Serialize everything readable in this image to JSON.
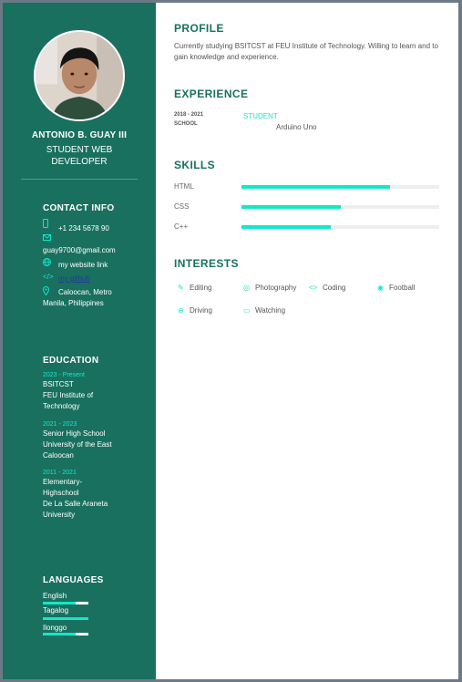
{
  "sidebar": {
    "name": "ANTONIO B. GUAY III",
    "role_line1": "STUDENT WEB",
    "role_line2": "DEVELOPER",
    "contact": {
      "heading": "CONTACT INFO",
      "phone": "+1 234 5678 90",
      "email": "guay9700@gmail.com",
      "website": "my website link",
      "github": "my github",
      "address_line1": "Caloocan, Metro",
      "address_line2": "Manila, Philippines"
    },
    "education": {
      "heading": "EDUCATION",
      "entries": [
        {
          "years": "2023 - Present",
          "lines": [
            "BSITCST",
            "FEU Institute of",
            "Technology"
          ]
        },
        {
          "years": "2021 - 2023",
          "lines": [
            "Senior High School",
            "University of the East",
            "Caloocan"
          ]
        },
        {
          "years": "2011 - 2021",
          "lines": [
            "Elementary-",
            "Highschool",
            "De La Salle Araneta",
            "University"
          ]
        }
      ]
    },
    "languages": {
      "heading": "LANGUAGES",
      "items": [
        {
          "name": "English",
          "level": 0.72
        },
        {
          "name": "Tagalog",
          "level": 1.0
        },
        {
          "name": "Ilonggo",
          "level": 0.72
        }
      ]
    }
  },
  "main": {
    "profile": {
      "heading": "PROFILE",
      "text": "Currently studying BSITCST at FEU Institute of Technology. Willing to learn and to gain knowledge and experience."
    },
    "experience": {
      "heading": "EXPERIENCE",
      "years": "2018 - 2021",
      "school": "SCHOOL",
      "title": "STUDENT",
      "description": "Arduino Uno"
    },
    "skills": {
      "heading": "SKILLS",
      "items": [
        {
          "name": "HTML",
          "level": 0.75
        },
        {
          "name": "CSS",
          "level": 0.5
        },
        {
          "name": "C++",
          "level": 0.45
        }
      ]
    },
    "interests": {
      "heading": "INTERESTS",
      "items": [
        {
          "name": "Editing",
          "icon": "pencil-icon"
        },
        {
          "name": "Photography",
          "icon": "camera-icon"
        },
        {
          "name": "Coding",
          "icon": "code-icon"
        },
        {
          "name": "Football",
          "icon": "football-icon"
        },
        {
          "name": "Driving",
          "icon": "car-icon"
        },
        {
          "name": "Watching",
          "icon": "tv-icon"
        }
      ]
    }
  },
  "colors": {
    "sidebar": "#19705f",
    "accent": "#13e8c9",
    "heading": "#19705f"
  }
}
